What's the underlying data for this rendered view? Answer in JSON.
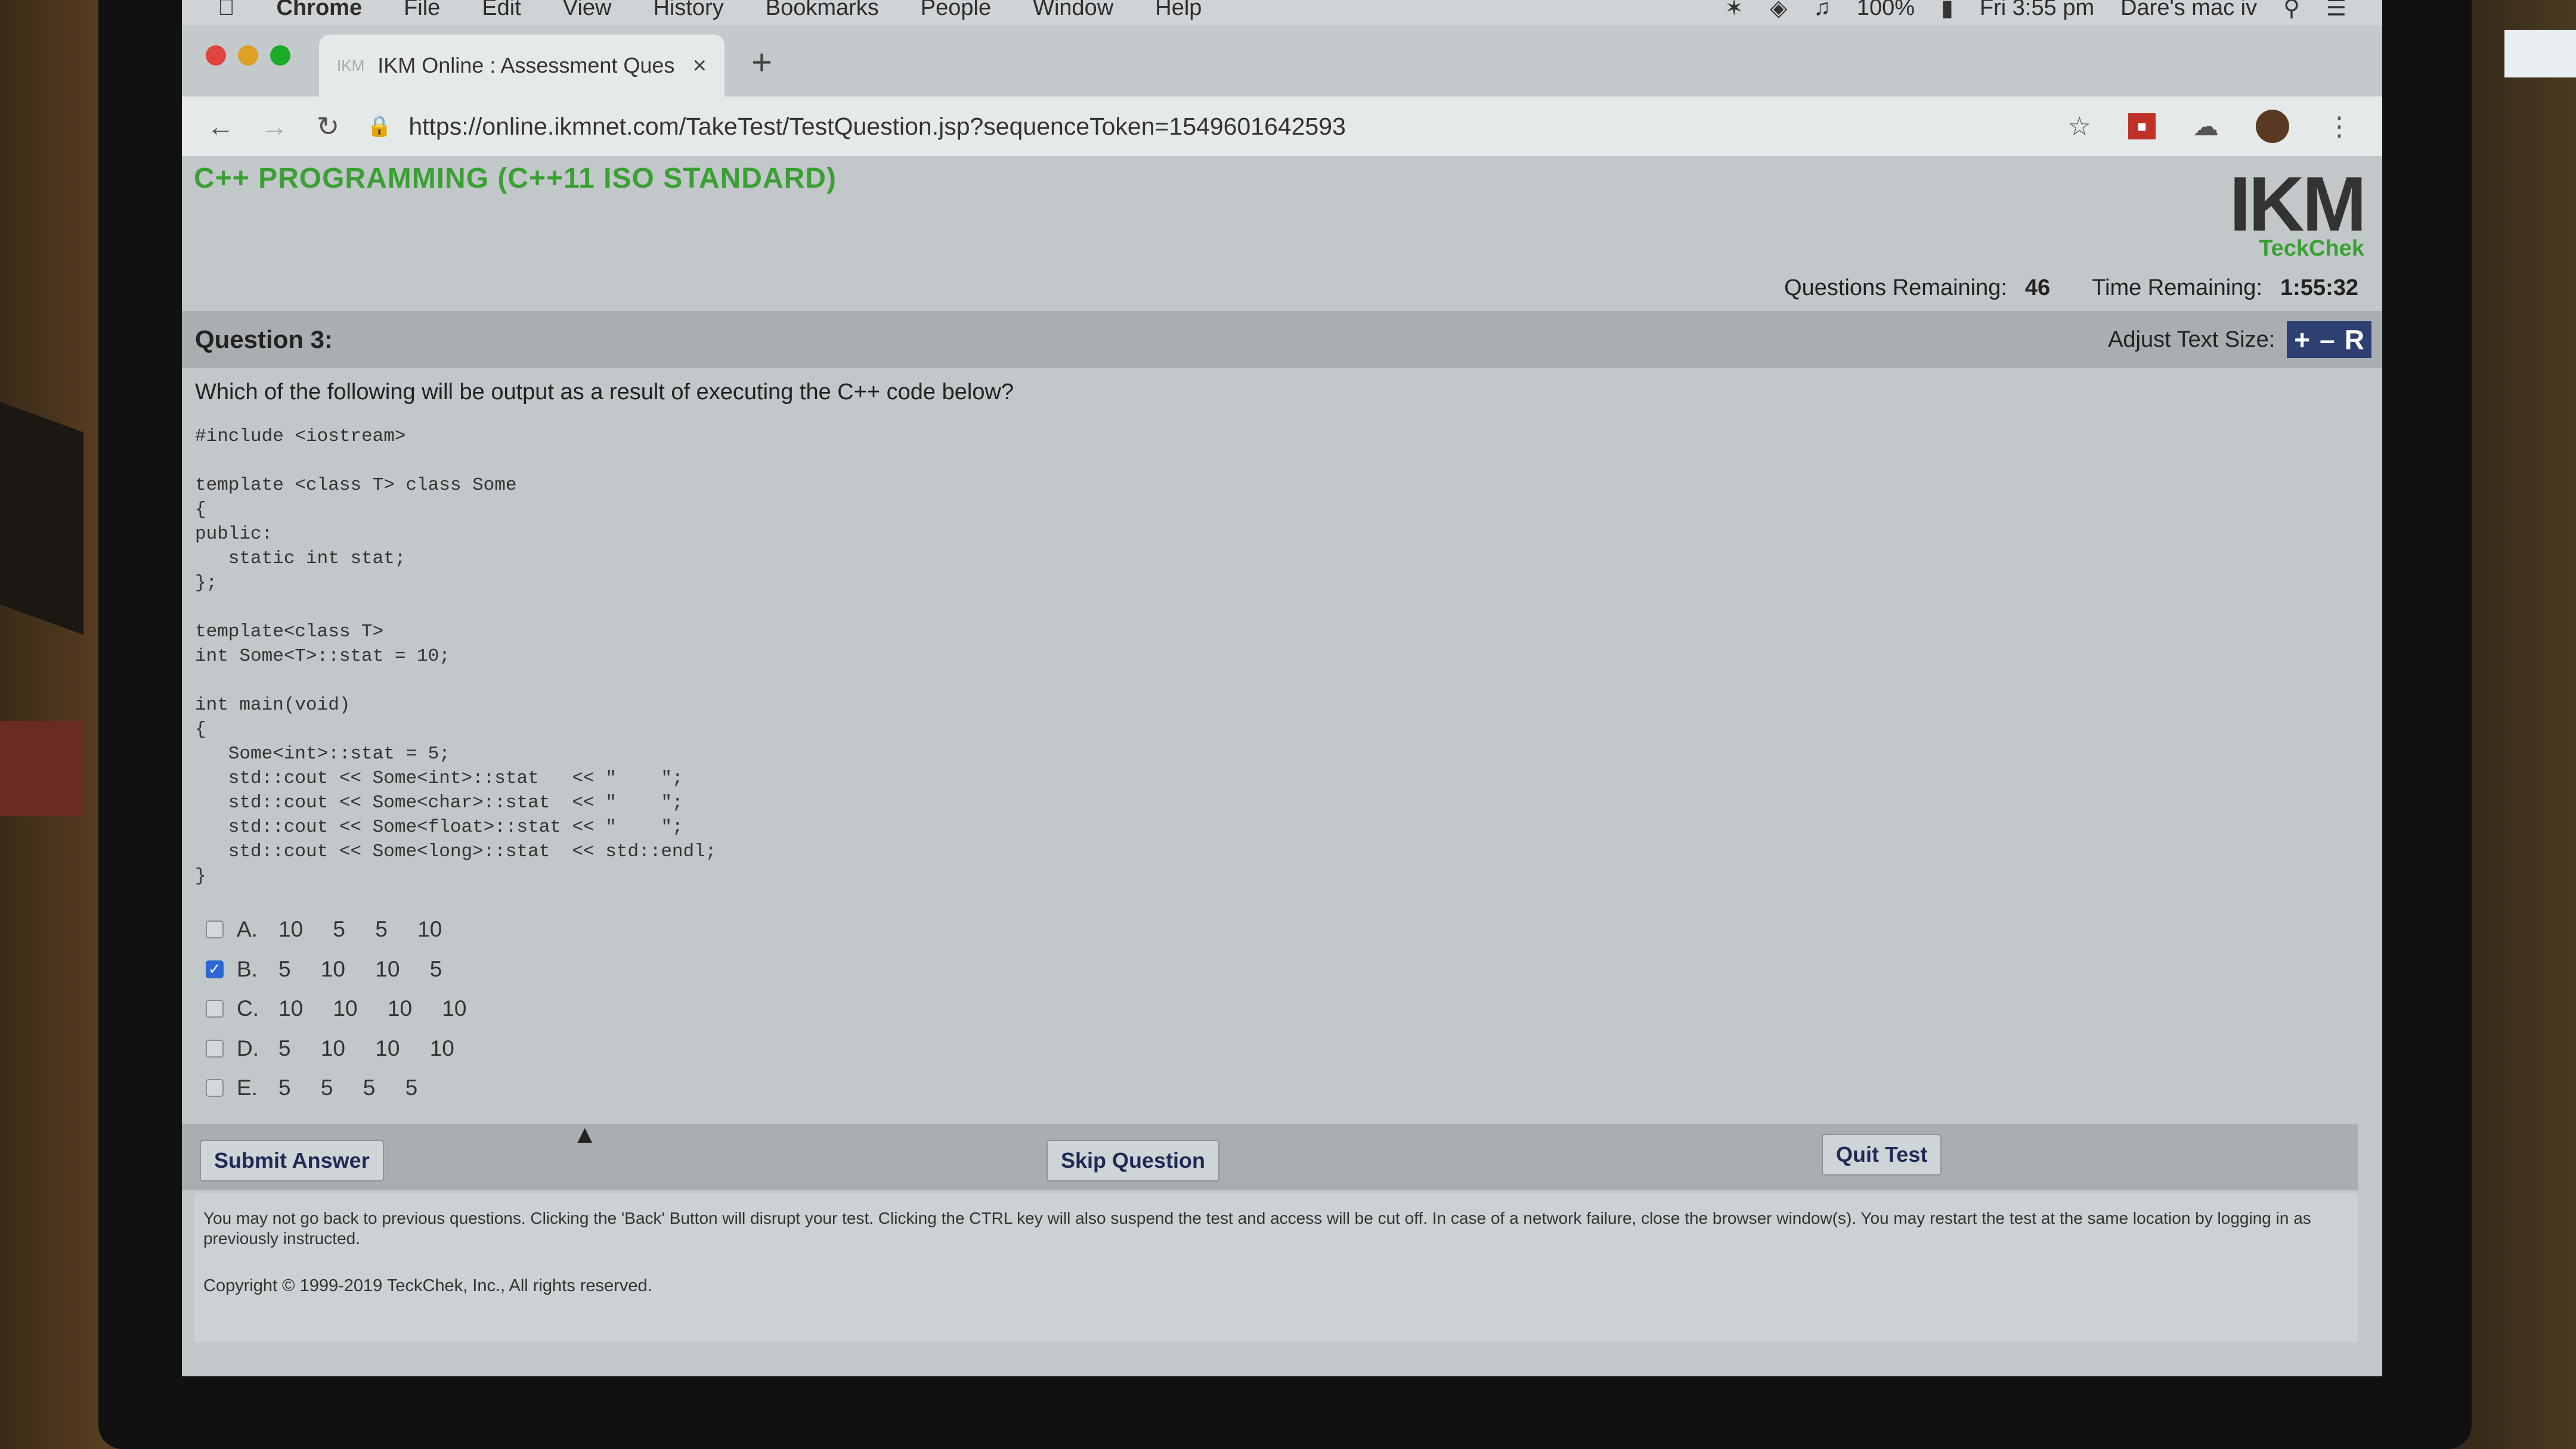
{
  "menubar": {
    "items": [
      "Chrome",
      "File",
      "Edit",
      "View",
      "History",
      "Bookmarks",
      "People",
      "Window",
      "Help"
    ],
    "battery": "100%",
    "clock": "Fri 3:55 pm",
    "user": "Dare's mac iv"
  },
  "browser": {
    "tab_favicon": "IKM",
    "tab_title": "IKM Online : Assessment Ques",
    "url": "https://online.ikmnet.com/TakeTest/TestQuestion.jsp?sequenceToken=1549601642593"
  },
  "header": {
    "course_title": "C++ PROGRAMMING (C++11 ISO STANDARD)",
    "logo_main": "IKM",
    "logo_sub": "TeckChek",
    "questions_remaining_label": "Questions Remaining:",
    "questions_remaining": "46",
    "time_remaining_label": "Time Remaining:",
    "time_remaining": "1:55:32"
  },
  "question": {
    "title": "Question 3:",
    "adjust_label": "Adjust Text Size:",
    "size_plus": "+",
    "size_minus": "–",
    "size_reset": "R",
    "prompt": "Which of the following will be output as a result of executing the C++ code below?",
    "code": "#include <iostream>\n\ntemplate <class T> class Some\n{\npublic:\n   static int stat;\n};\n\ntemplate<class T>\nint Some<T>::stat = 10;\n\nint main(void)\n{\n   Some<int>::stat = 5;\n   std::cout << Some<int>::stat   << \"    \";\n   std::cout << Some<char>::stat  << \"    \";\n   std::cout << Some<float>::stat << \"    \";\n   std::cout << Some<long>::stat  << std::endl;\n}",
    "options": [
      {
        "letter": "A.",
        "values": "10 5 5 10",
        "checked": false
      },
      {
        "letter": "B.",
        "values": "5 10 10 5",
        "checked": true
      },
      {
        "letter": "C.",
        "values": "10 10 10 10",
        "checked": false
      },
      {
        "letter": "D.",
        "values": "5 10 10 10",
        "checked": false
      },
      {
        "letter": "E.",
        "values": "5 5 5 5",
        "checked": false
      }
    ]
  },
  "buttons": {
    "submit": "Submit Answer",
    "skip": "Skip Question",
    "quit": "Quit Test"
  },
  "footer": {
    "note": "You may not go back to previous questions. Clicking the 'Back' Button will disrupt your test. Clicking the CTRL key will also suspend the test and access will be cut off. In case of a network failure, close the browser window(s). You may restart the test at the same location by logging in as previously instructed.",
    "copyright": "Copyright © 1999-2019 TeckChek, Inc., All rights reserved."
  },
  "colors": {
    "course_title": "#3aa033",
    "checkbox_checked": "#2a66d4",
    "size_buttons": "#2e3f72"
  }
}
